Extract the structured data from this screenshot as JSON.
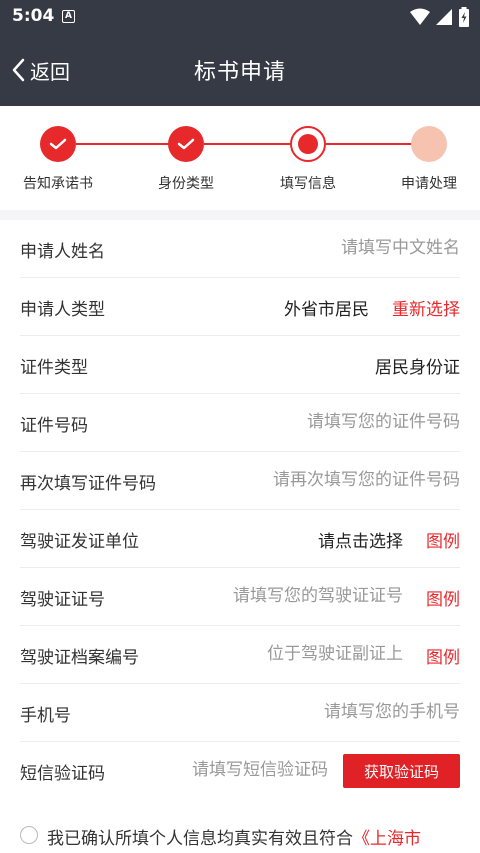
{
  "status_bar": {
    "time": "5:04",
    "badge": "A",
    "icons": [
      "wifi-icon",
      "signal-icon",
      "battery-icon"
    ]
  },
  "nav": {
    "back_label": "返回",
    "title": "标书申请"
  },
  "steps": [
    {
      "label": "告知承诺书",
      "state": "done"
    },
    {
      "label": "身份类型",
      "state": "done"
    },
    {
      "label": "填写信息",
      "state": "current"
    },
    {
      "label": "申请处理",
      "state": "todo"
    }
  ],
  "form": {
    "applicant_name": {
      "label": "申请人姓名",
      "placeholder": "请填写中文姓名"
    },
    "applicant_type": {
      "label": "申请人类型",
      "value": "外省市居民",
      "action": "重新选择"
    },
    "id_type": {
      "label": "证件类型",
      "value": "居民身份证"
    },
    "id_number": {
      "label": "证件号码",
      "placeholder": "请填写您的证件号码"
    },
    "id_number_confirm": {
      "label": "再次填写证件号码",
      "placeholder": "请再次填写您的证件号码"
    },
    "license_issuer": {
      "label": "驾驶证发证单位",
      "value": "请点击选择",
      "example": "图例"
    },
    "license_number": {
      "label": "驾驶证证号",
      "placeholder": "请填写您的驾驶证证号",
      "example": "图例"
    },
    "license_file_number": {
      "label": "驾驶证档案编号",
      "placeholder": "位于驾驶证副证上",
      "example": "图例"
    },
    "phone": {
      "label": "手机号",
      "placeholder": "请填写您的手机号"
    },
    "sms_code": {
      "label": "短信验证码",
      "placeholder": "请填写短信验证码",
      "button": "获取验证码"
    }
  },
  "consent": {
    "text": "我已确认所填个人信息均真实有效且符合",
    "link": "《上海市"
  },
  "colors": {
    "header_bg": "#353a45",
    "accent": "#e8292c",
    "step_todo": "#f5c3b0"
  }
}
